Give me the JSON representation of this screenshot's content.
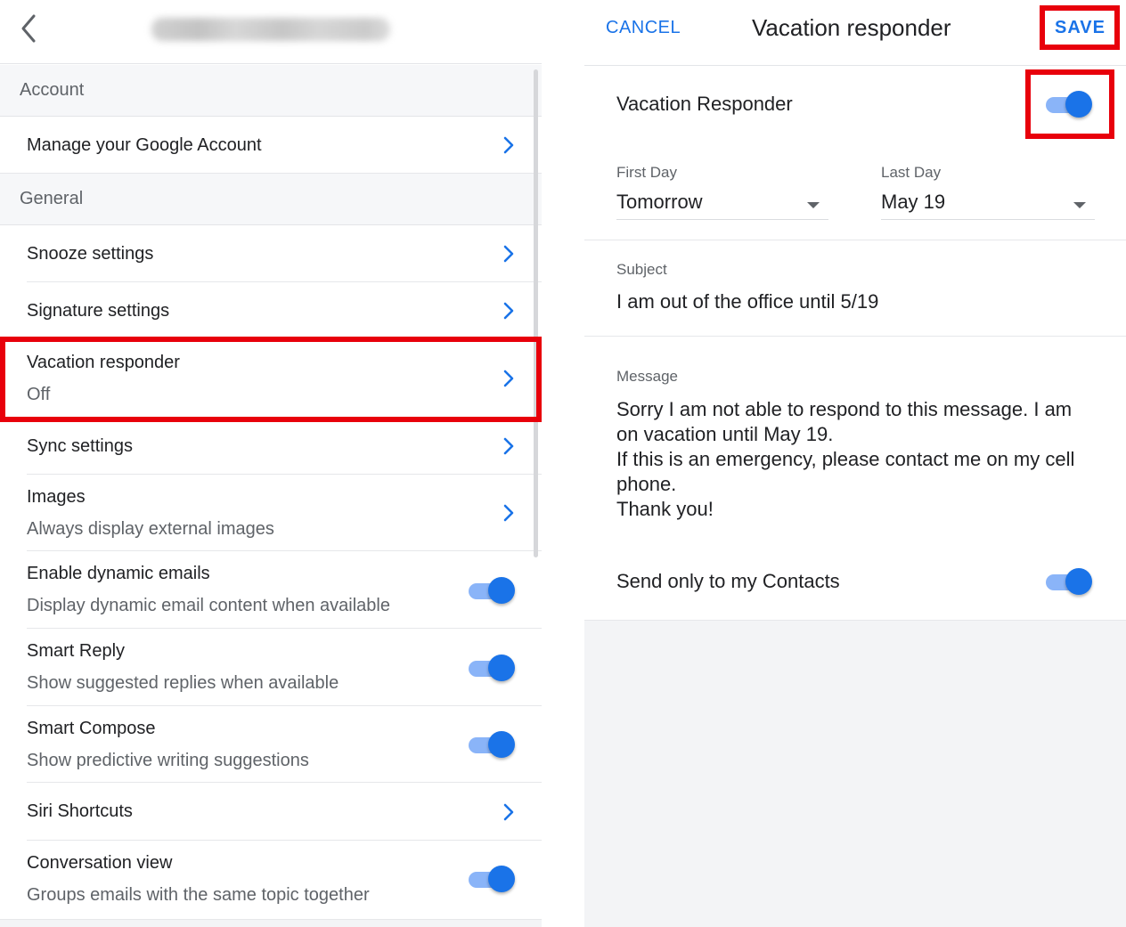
{
  "left_panel": {
    "account_email": "(blurred account email)",
    "sections": [
      {
        "header": "Account",
        "items": [
          {
            "title": "Manage your Google Account",
            "subtitle": null,
            "control": "chevron"
          }
        ]
      },
      {
        "header": "General",
        "items": [
          {
            "title": "Snooze settings",
            "subtitle": null,
            "control": "chevron"
          },
          {
            "title": "Signature settings",
            "subtitle": null,
            "control": "chevron"
          },
          {
            "title": "Vacation responder",
            "subtitle": "Off",
            "control": "chevron",
            "highlighted": true
          },
          {
            "title": "Sync settings",
            "subtitle": null,
            "control": "chevron"
          },
          {
            "title": "Images",
            "subtitle": "Always display external images",
            "control": "chevron"
          },
          {
            "title": "Enable dynamic emails",
            "subtitle": "Display dynamic email content when available",
            "control": "toggle",
            "on": true
          },
          {
            "title": "Smart Reply",
            "subtitle": "Show suggested replies when available",
            "control": "toggle",
            "on": true
          },
          {
            "title": "Smart Compose",
            "subtitle": "Show predictive writing suggestions",
            "control": "toggle",
            "on": true
          },
          {
            "title": "Siri Shortcuts",
            "subtitle": null,
            "control": "chevron"
          },
          {
            "title": "Conversation view",
            "subtitle": "Groups emails with the same topic together",
            "control": "toggle",
            "on": true
          }
        ]
      }
    ]
  },
  "right_panel": {
    "cancel_label": "CANCEL",
    "title": "Vacation responder",
    "save_label": "SAVE",
    "vacation_responder_label": "Vacation Responder",
    "vacation_responder_on": true,
    "first_day": {
      "label": "First Day",
      "value": "Tomorrow"
    },
    "last_day": {
      "label": "Last Day",
      "value": "May 19"
    },
    "subject": {
      "label": "Subject",
      "value": "I am out of the office until 5/19"
    },
    "message": {
      "label": "Message",
      "value": "Sorry I am not able to respond to this message. I am on vacation until May 19.\nIf this is an emergency, please contact me on my cell phone.\nThank you!"
    },
    "send_only_contacts_label": "Send only to my Contacts",
    "send_only_contacts_on": true
  },
  "colors": {
    "accent": "#1a73e8",
    "toggle_track": "#8ab4f8",
    "highlight_box": "#e8000b",
    "section_bg": "#f6f7f9",
    "secondary_text": "#5f6368"
  }
}
